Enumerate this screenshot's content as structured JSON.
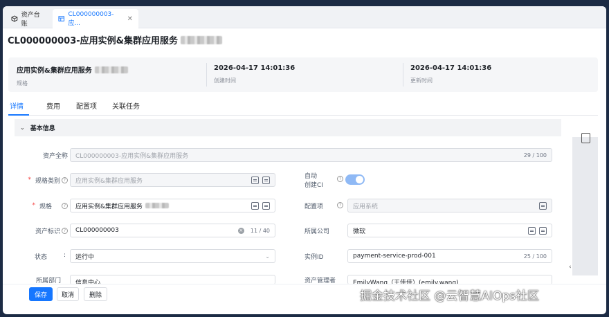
{
  "tabs": [
    {
      "label": "资产台账",
      "icon": "cube-icon"
    },
    {
      "label": "CL000000003-应...",
      "icon": "table-icon"
    }
  ],
  "page": {
    "title": "CL000000003-应用实例&集群应用服务"
  },
  "summary": [
    {
      "value": "应用实例&集群应用服务",
      "label": "规格"
    },
    {
      "value": "2026-04-17 14:01:36",
      "label": "创建时间"
    },
    {
      "value": "2026-04-17 14:01:36",
      "label": "更新时间"
    }
  ],
  "subtabs": [
    "详情",
    "费用",
    "配置项",
    "关联任务"
  ],
  "section": {
    "title": "基本信息"
  },
  "fields": {
    "full_name": {
      "label": "资产全称",
      "value": "CL000000003-应用实例&集群应用服务",
      "count": "29 / 100"
    },
    "spec_type": {
      "label": "规格类别",
      "value": "应用实例&集群应用服务"
    },
    "auto_ci": {
      "label_line1": "自动",
      "label_line2": "创建CI",
      "on": true
    },
    "spec": {
      "label": "规格",
      "value": "应用实例&集群应用服务"
    },
    "config_item": {
      "label": "配置项",
      "value": "应用系统"
    },
    "asset_id": {
      "label": "资产标识",
      "value": "CL000000003",
      "count": "11 / 40"
    },
    "company": {
      "label": "所属公司",
      "value": "微软"
    },
    "status": {
      "label": "状态",
      "value": "运行中"
    },
    "instance_id": {
      "label": "实例ID",
      "value": "payment-service-prod-001",
      "count": "25 / 100"
    },
    "department": {
      "label": "所属部门",
      "value": "信息中心"
    },
    "admin": {
      "label": "资产管理者",
      "value": "EmilyWang（王佳佳）(emily.wang)"
    }
  },
  "buttons": {
    "save": "保存",
    "cancel": "取消",
    "delete": "删除"
  },
  "watermark": "掘金技术社区 @云智慧AIOps社区",
  "colors": {
    "accent": "#1677ff",
    "required": "#f53f3f"
  }
}
